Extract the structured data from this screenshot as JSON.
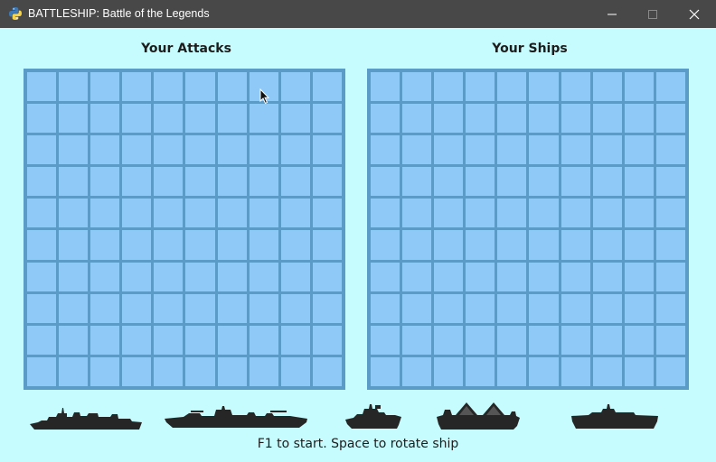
{
  "window": {
    "title": "BATTLESHIP: Battle of the Legends",
    "icon": "python-icon",
    "controls": [
      "minimize",
      "maximize",
      "close"
    ]
  },
  "boards": {
    "attacks": {
      "title": "Your Attacks",
      "rows": 10,
      "cols": 10
    },
    "ships": {
      "title": "Your Ships",
      "rows": 10,
      "cols": 10
    }
  },
  "fleet": [
    "destroyer-silhouette",
    "battleship-silhouette",
    "patrol-boat-silhouette",
    "cruiser-silhouette",
    "submarine-silhouette"
  ],
  "colors": {
    "background": "#c6fcfd",
    "grid_border": "#5b9bc7",
    "cell": "#8ec9f8",
    "ship": "#262626",
    "titlebar": "#484848"
  },
  "status": {
    "hint": "F1 to start. Space to rotate ship"
  }
}
